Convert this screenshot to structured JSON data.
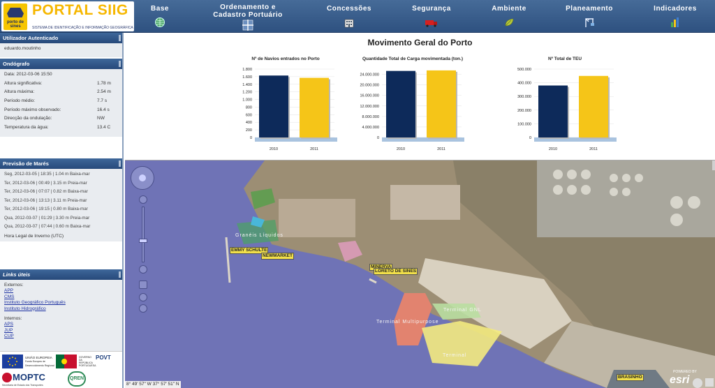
{
  "header": {
    "logo_title": "PORTAL SIIG",
    "logo_sub": "SISTEMA DE IDENTIFICAÇÃO E INFORMAÇÃO GEOGRÁFICA",
    "logo_mark_label": "porto de sines",
    "nav": [
      {
        "label": "Base",
        "icon": "globe-icon"
      },
      {
        "label": "Ordenamento e Cadastro Portuário",
        "icon": "grid-crosshair-icon"
      },
      {
        "label": "Concessões",
        "icon": "building-icon"
      },
      {
        "label": "Segurança",
        "icon": "truck-icon"
      },
      {
        "label": "Ambiente",
        "icon": "leaf-icon"
      },
      {
        "label": "Planeamento",
        "icon": "crane-icon"
      },
      {
        "label": "Indicadores",
        "icon": "bar-chart-icon"
      }
    ]
  },
  "sidebar": {
    "user": {
      "title": "Utilizador Autenticado",
      "name": "eduardo.moutinho"
    },
    "ondografo": {
      "title": "Ondógrafo",
      "rows": [
        {
          "k": "Data: 2012-03-06 15:50",
          "v": ""
        },
        {
          "k": "Altura significativa:",
          "v": "1.78 m"
        },
        {
          "k": "Altura máxima:",
          "v": "2.54 m"
        },
        {
          "k": "Período médio:",
          "v": "7.7 s"
        },
        {
          "k": "Período máximo observado:",
          "v": "16.4 s"
        },
        {
          "k": "Direcção da ondulação:",
          "v": "NW"
        },
        {
          "k": "Temperatura da água:",
          "v": "13.4 C"
        }
      ]
    },
    "mares": {
      "title": "Previsão de Marés",
      "rows": [
        "Seg, 2012-03-05 | 18:35 | 1.04 m Baixa-mar",
        "Ter, 2012-03-06 | 00:49 | 3.15 m Preia-mar",
        "Ter, 2012-03-06 | 07:07 | 0.82 m Baixa-mar",
        "Ter, 2012-03-06 | 13:13 | 3.11 m Preia-mar",
        "Ter, 2012-03-06 | 19:15 | 0.80 m Baixa-mar",
        "Qua, 2012-03-07 | 01:29 | 3.30 m Preia-mar",
        "Qua, 2012-03-07 | 07:44 | 0.60 m Baixa-mar"
      ],
      "footer": "Hora Legal de Inverno (UTC)"
    },
    "links": {
      "title": "Links úteis",
      "externos_label": "Externos:",
      "externos": [
        "APP",
        "CMS",
        "Instituto Geográfico Português",
        "Instituto Hidrográfico"
      ],
      "internos_label": "Internos:",
      "internos": [
        "APS",
        "JUP",
        "CUP"
      ]
    },
    "footer_logos": {
      "eu": "UNIÃO EUROPEIA",
      "eu_sub": "Fundo Europeu de Desenvolvimento Regional",
      "pt": "GOVERNO DA REPÚBLICA PORTUGUESA",
      "povt": "POVT",
      "moptc": "MOPTC",
      "moptc_sub": "Secretaria de Estado dos Transportes",
      "qren": "QREN"
    }
  },
  "charts_panel": {
    "title": "Movimento Geral do Porto",
    "colors": {
      "2010": "#0d2a5a",
      "2011": "#f5c518",
      "base": "#a9c3df"
    }
  },
  "chart_data": [
    {
      "type": "bar",
      "title": "Nº de Navios entrados no Porto",
      "categories": [
        "2010",
        "2011"
      ],
      "values": [
        1630,
        1570
      ],
      "ylim": [
        0,
        1800
      ],
      "yticks": [
        "0",
        "200",
        "400",
        "600",
        "800",
        "1.000",
        "1.200",
        "1.400",
        "1.600",
        "1.800"
      ],
      "ytick_values": [
        0,
        200,
        400,
        600,
        800,
        1000,
        1200,
        1400,
        1600,
        1800
      ]
    },
    {
      "type": "bar",
      "title": "Quantidade Total de Carga movimentada (ton.)",
      "categories": [
        "2010",
        "2011"
      ],
      "values": [
        25300000,
        25500000
      ],
      "ylim": [
        0,
        26000000
      ],
      "yticks": [
        "0",
        "4.000.000",
        "8.000.000",
        "12.000.000",
        "16.000.000",
        "20.000.000",
        "24.000.000"
      ],
      "ytick_values": [
        0,
        4000000,
        8000000,
        12000000,
        16000000,
        20000000,
        24000000
      ]
    },
    {
      "type": "bar",
      "title": "Nº Total de TEU",
      "categories": [
        "2010",
        "2011"
      ],
      "values": [
        380000,
        450000
      ],
      "ylim": [
        0,
        500000
      ],
      "yticks": [
        "0",
        "100.000",
        "200.000",
        "300.000",
        "400.000",
        "500.000"
      ],
      "ytick_values": [
        0,
        100000,
        200000,
        300000,
        400000,
        500000
      ]
    }
  ],
  "map": {
    "labels": [
      {
        "text": "EMMY SCHULTE"
      },
      {
        "text": "NEWMARKET"
      },
      {
        "text": "MINERVA"
      },
      {
        "text": "LORETO DE SINES"
      },
      {
        "text": "BRASINHO"
      }
    ],
    "area_labels": [
      "Granéis Líquidos",
      "Terminal GNL",
      "Terminal Multipurpose",
      "Terminal"
    ],
    "coords": "8° 49' 57\" W 37° 57' 51\" N",
    "esri": "esri",
    "powered": "POWERED BY"
  }
}
